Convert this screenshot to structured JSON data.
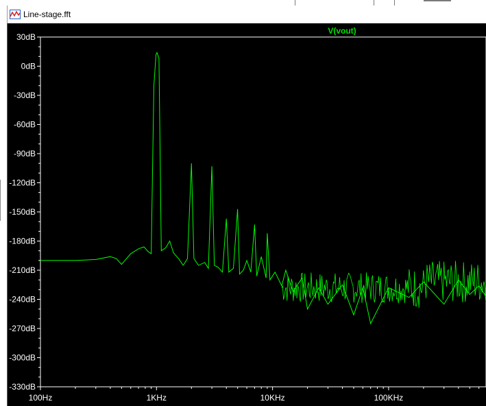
{
  "window": {
    "title": "Line-stage.fft",
    "icon": "waveform-icon"
  },
  "colors": {
    "plot_bg": "#000000",
    "trace": "#00ff00",
    "axis": "#ffffff",
    "trace_label": "#00e000"
  },
  "chart_data": {
    "type": "line",
    "title": "",
    "xlabel": "",
    "ylabel": "",
    "x_scale": "log",
    "xlim": [
      100,
      700000
    ],
    "ylim": [
      -330,
      30
    ],
    "grid": false,
    "legend": "top-center",
    "x_ticks": [
      "100Hz",
      "1KHz",
      "10KHz",
      "100KHz"
    ],
    "y_ticks": [
      "30dB",
      "0dB",
      "-30dB",
      "-60dB",
      "-90dB",
      "-120dB",
      "-150dB",
      "-180dB",
      "-210dB",
      "-240dB",
      "-270dB",
      "-300dB",
      "-330dB"
    ],
    "series": [
      {
        "name": "V(vout)",
        "points": [
          [
            100,
            -200
          ],
          [
            150,
            -200
          ],
          [
            200,
            -200
          ],
          [
            300,
            -199
          ],
          [
            400,
            -196
          ],
          [
            450,
            -198
          ],
          [
            500,
            -204
          ],
          [
            600,
            -193
          ],
          [
            700,
            -188
          ],
          [
            780,
            -186
          ],
          [
            850,
            -191
          ],
          [
            900,
            -193
          ],
          [
            950,
            -20
          ],
          [
            990,
            12
          ],
          [
            1010,
            14
          ],
          [
            1050,
            8
          ],
          [
            1100,
            -190
          ],
          [
            1200,
            -187
          ],
          [
            1300,
            -180
          ],
          [
            1400,
            -192
          ],
          [
            1550,
            -198
          ],
          [
            1700,
            -205
          ],
          [
            1850,
            -198
          ],
          [
            2000,
            -100
          ],
          [
            2100,
            -198
          ],
          [
            2300,
            -205
          ],
          [
            2600,
            -202
          ],
          [
            2800,
            -208
          ],
          [
            3000,
            -103
          ],
          [
            3150,
            -205
          ],
          [
            3400,
            -207
          ],
          [
            3700,
            -212
          ],
          [
            4000,
            -157
          ],
          [
            4200,
            -212
          ],
          [
            4600,
            -208
          ],
          [
            5000,
            -147
          ],
          [
            5200,
            -214
          ],
          [
            5600,
            -210
          ],
          [
            6000,
            -200
          ],
          [
            6500,
            -212
          ],
          [
            7000,
            -163
          ],
          [
            7300,
            -216
          ],
          [
            8000,
            -196
          ],
          [
            8800,
            -218
          ],
          [
            9000,
            -172
          ],
          [
            9500,
            -220
          ],
          [
            10500,
            -212
          ],
          [
            12000,
            -226
          ],
          [
            13000,
            -210
          ],
          [
            15000,
            -232
          ],
          [
            18000,
            -218
          ],
          [
            20000,
            -250
          ],
          [
            25000,
            -228
          ],
          [
            30000,
            -245
          ],
          [
            40000,
            -225
          ],
          [
            50000,
            -256
          ],
          [
            60000,
            -228
          ],
          [
            70000,
            -265
          ],
          [
            100000,
            -228
          ],
          [
            150000,
            -238
          ],
          [
            200000,
            -222
          ],
          [
            300000,
            -245
          ],
          [
            400000,
            -220
          ],
          [
            500000,
            -235
          ],
          [
            600000,
            -226
          ],
          [
            700000,
            -238
          ]
        ]
      }
    ]
  }
}
